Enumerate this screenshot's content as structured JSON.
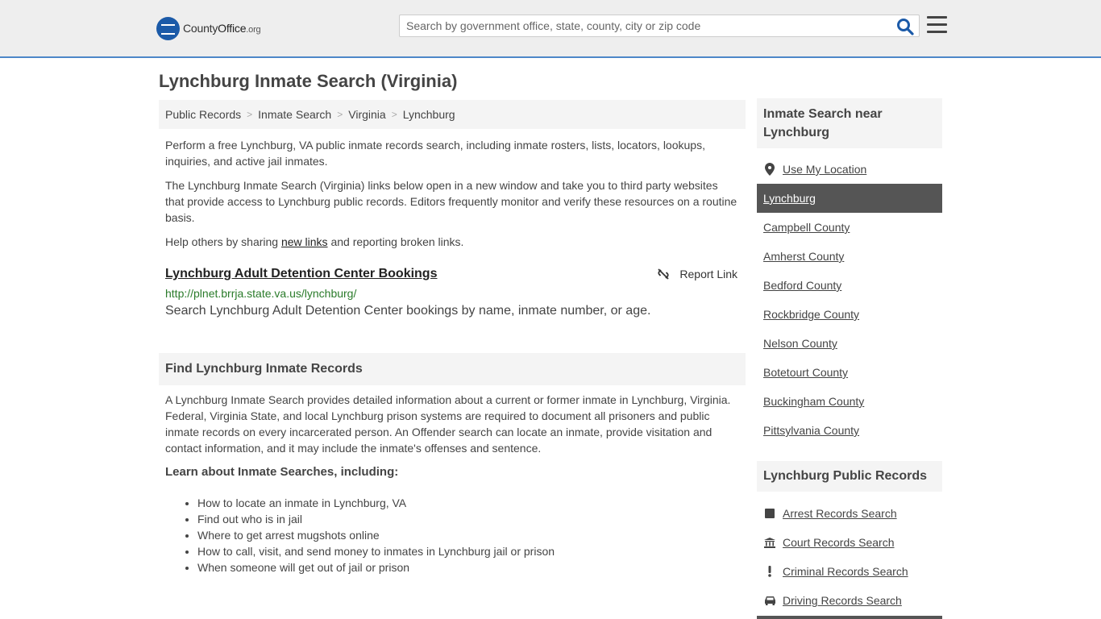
{
  "header": {
    "logo_county": "County",
    "logo_office": "Office",
    "logo_org": ".org",
    "search_placeholder": "Search by government office, state, county, city or zip code"
  },
  "page_title": "Lynchburg Inmate Search (Virginia)",
  "breadcrumb": [
    "Public Records",
    "Inmate Search",
    "Virginia",
    "Lynchburg"
  ],
  "intro": {
    "p1": "Perform a free Lynchburg, VA public inmate records search, including inmate rosters, lists, locators, lookups, inquiries, and active jail inmates.",
    "p2": "The Lynchburg Inmate Search (Virginia) links below open in a new window and take you to third party websites that provide access to Lynchburg public records. Editors frequently monitor and verify these resources on a routine basis.",
    "p3_before": "Help others by sharing ",
    "p3_link": "new links",
    "p3_after": " and reporting broken links."
  },
  "result": {
    "title": "Lynchburg Adult Detention Center Bookings",
    "url": "http://plnet.brrja.state.va.us/lynchburg/",
    "description": "Search Lynchburg Adult Detention Center bookings by name, inmate number, or age.",
    "report_label": "Report Link"
  },
  "find_section": {
    "heading": "Find Lynchburg Inmate Records",
    "body": "A Lynchburg Inmate Search provides detailed information about a current or former inmate in Lynchburg, Virginia. Federal, Virginia State, and local Lynchburg prison systems are required to document all prisoners and public inmate records on every incarcerated person. An Offender search can locate an inmate, provide visitation and contact information, and it may include the inmate's offenses and sentence.",
    "learn_heading": "Learn about Inmate Searches, including:",
    "learn_items": [
      "How to locate an inmate in Lynchburg, VA",
      "Find out who is in jail",
      "Where to get arrest mugshots online",
      "How to call, visit, and send money to inmates in Lynchburg jail or prison",
      "When someone will get out of jail or prison"
    ]
  },
  "sidebar": {
    "near_heading": "Inmate Search near Lynchburg",
    "use_location": "Use My Location",
    "locations": [
      "Lynchburg",
      "Campbell County",
      "Amherst County",
      "Bedford County",
      "Rockbridge County",
      "Nelson County",
      "Botetourt County",
      "Buckingham County",
      "Pittsylvania County"
    ],
    "records_heading": "Lynchburg Public Records",
    "records": [
      {
        "label": "Arrest Records Search",
        "icon": "square-icon"
      },
      {
        "label": "Court Records Search",
        "icon": "courthouse-icon"
      },
      {
        "label": "Criminal Records Search",
        "icon": "exclamation-icon"
      },
      {
        "label": "Driving Records Search",
        "icon": "car-icon"
      }
    ]
  },
  "colors": {
    "topbar_bg": "#eeeeee",
    "topbar_border": "#4d87c8",
    "active_item_bg": "#555555",
    "url_green": "#2a7b2a",
    "search_icon": "#1b5aa8"
  }
}
